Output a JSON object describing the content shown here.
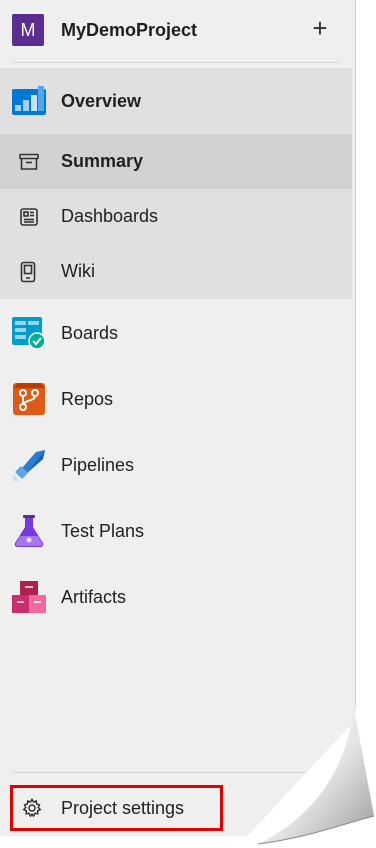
{
  "project": {
    "avatar_letter": "M",
    "name": "MyDemoProject",
    "add_glyph": "+"
  },
  "nav": {
    "overview": {
      "label": "Overview",
      "icon": "overview-icon"
    },
    "summary": {
      "label": "Summary",
      "icon": "summary-icon",
      "selected": true
    },
    "dashboards": {
      "label": "Dashboards",
      "icon": "dashboards-icon"
    },
    "wiki": {
      "label": "Wiki",
      "icon": "wiki-icon"
    },
    "boards": {
      "label": "Boards",
      "icon": "boards-icon"
    },
    "repos": {
      "label": "Repos",
      "icon": "repos-icon"
    },
    "pipelines": {
      "label": "Pipelines",
      "icon": "pipelines-icon"
    },
    "testplans": {
      "label": "Test Plans",
      "icon": "test-plans-icon"
    },
    "artifacts": {
      "label": "Artifacts",
      "icon": "artifacts-icon"
    }
  },
  "footer": {
    "settings_label": "Project settings",
    "icon": "gear-icon"
  },
  "colors": {
    "avatar": "#5c2d91",
    "highlight_border": "#e00000",
    "boards": "#009ccc",
    "repos": "#e05a17",
    "pipelines": "#2b7cd3",
    "testplans": "#773adc",
    "artifacts": "#cb2e6d"
  }
}
